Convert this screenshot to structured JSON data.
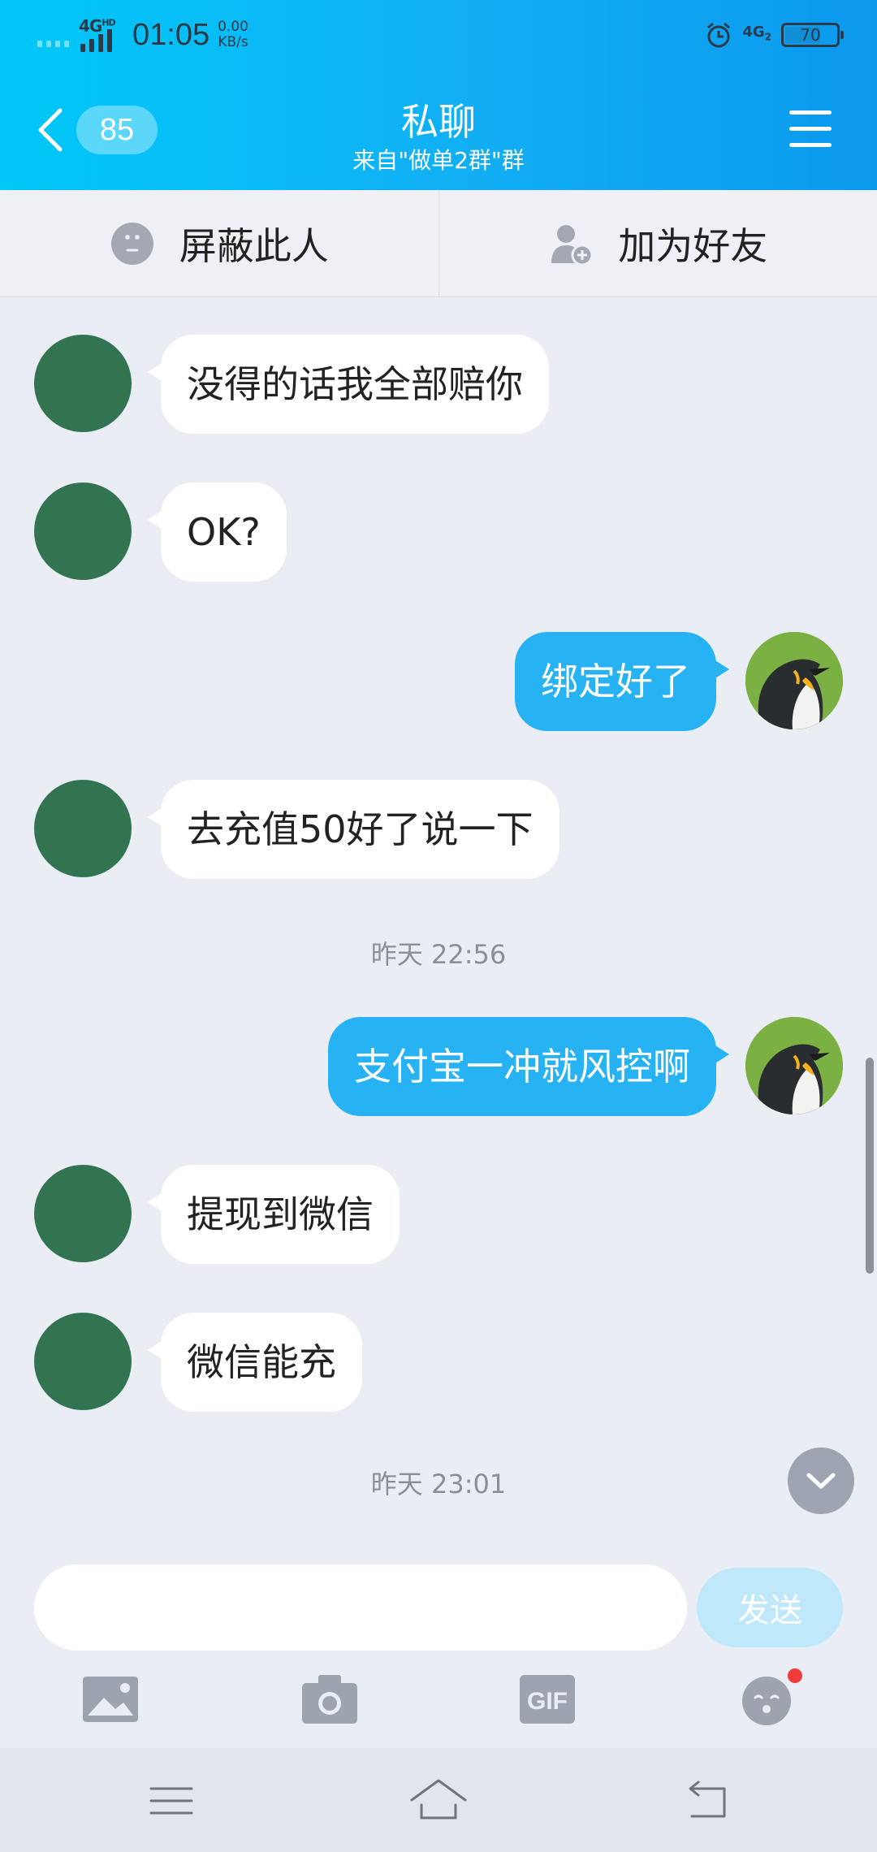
{
  "status_bar": {
    "network": "4G",
    "network_sup": "HD",
    "time": "01:05",
    "speed_value": "0.00",
    "speed_unit": "KB/s",
    "network2": "4G",
    "network2_sub": "2",
    "battery": "70",
    "battery_level": 0.7,
    "icons": [
      "signal-icon",
      "alarm-icon",
      "battery-icon"
    ]
  },
  "header": {
    "unread_count": "85",
    "title": "私聊",
    "subtitle": "来自\"做单2群\"群",
    "icons": [
      "back-chevron-icon",
      "menu-icon"
    ]
  },
  "actions": {
    "block_label": "屏蔽此人",
    "add_friend_label": "加为好友",
    "icons": [
      "block-icon",
      "add-friend-icon"
    ]
  },
  "messages": [
    {
      "side": "in",
      "text": "没得的话我全部赔你"
    },
    {
      "side": "in",
      "text": "OK?"
    },
    {
      "side": "out",
      "text": "绑定好了"
    },
    {
      "side": "in",
      "text": "去充值50好了说一下"
    },
    {
      "side": "time",
      "text": "昨天 22:56"
    },
    {
      "side": "out",
      "text": "支付宝一冲就风控啊"
    },
    {
      "side": "in",
      "text": "提现到微信"
    },
    {
      "side": "in",
      "text": "微信能充"
    },
    {
      "side": "time",
      "text": "昨天 23:01"
    }
  ],
  "composer": {
    "input_value": "",
    "send_label": "发送"
  },
  "toolbar": {
    "items": [
      "image-icon",
      "camera-icon",
      "gif-icon",
      "emoji-icon"
    ],
    "gif_label": "GIF"
  },
  "nav": {
    "items": [
      "menu-nav-icon",
      "home-nav-icon",
      "back-nav-icon"
    ]
  },
  "colors": {
    "header_start": "#00c8f7",
    "header_end": "#0b99ee",
    "outgoing_bubble": "#27b2f4",
    "incoming_bubble": "#ffffff",
    "avatar_placeholder": "#327452",
    "send_button": "#bfe9fb",
    "chat_background": "#eaedf4"
  }
}
